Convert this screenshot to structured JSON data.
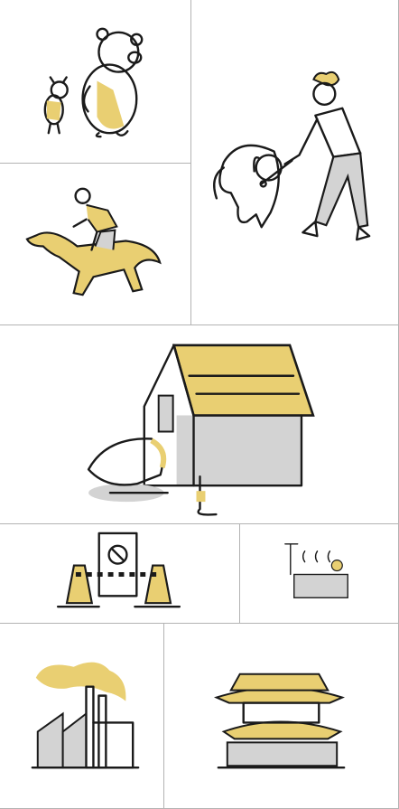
{
  "gallery": {
    "background": "#ffffff",
    "divider_color": "#b3b3b3",
    "accent_color": "#e9cf72",
    "shadow_color": "#d3d3d3",
    "ink_color": "#1a1a1a",
    "illustrations": [
      {
        "icon": "pooh-and-piglet-icon"
      },
      {
        "icon": "man-playing-with-dog-icon"
      },
      {
        "icon": "jockey-horse-racing-icon"
      },
      {
        "icon": "dog-in-doghouse-icon"
      },
      {
        "icon": "no-entry-barrier-icon"
      },
      {
        "icon": "bath-shower-icon"
      },
      {
        "icon": "factory-smoke-icon"
      },
      {
        "icon": "japanese-temple-icon"
      }
    ]
  }
}
